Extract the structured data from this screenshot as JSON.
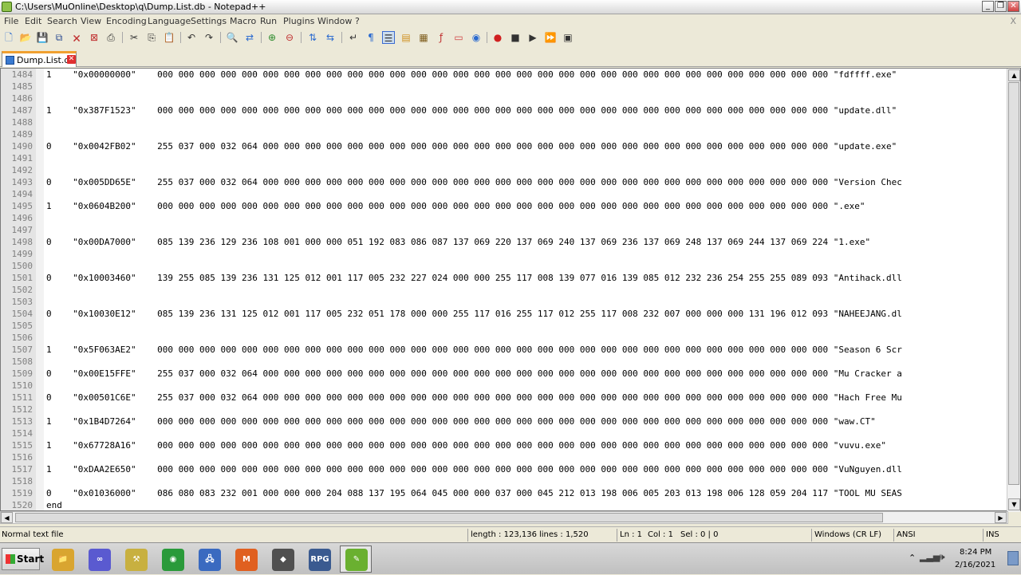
{
  "window": {
    "title": "C:\\Users\\MuOnline\\Desktop\\q\\Dump.List.db - Notepad++",
    "minimize": "_",
    "restore": "❐",
    "close": "✕"
  },
  "menu": [
    "File",
    "Edit",
    "Search",
    "View",
    "Encoding",
    "Language",
    "Settings",
    "Macro",
    "Run",
    "Plugins",
    "Window",
    "?"
  ],
  "menu_close": "X",
  "toolbar": [
    "new-file",
    "open-file",
    "save",
    "save-all",
    "close",
    "close-all",
    "print",
    "cut",
    "copy",
    "paste",
    "undo",
    "redo",
    "find",
    "replace",
    "zoom-in",
    "zoom-out",
    "sync-vertical",
    "sync-horizontal",
    "word-wrap",
    "show-all-chars",
    "indent-guide",
    "language",
    "doc-map",
    "function-list",
    "folder-workspace",
    "monitor",
    "record-macro",
    "stop-record",
    "play-macro",
    "run-macro-multiple",
    "save-macro"
  ],
  "tab": {
    "label": "Dump.List.db",
    "close": "✕"
  },
  "editor": {
    "lines": [
      {
        "n": "1484",
        "t": "1    \"0x00000000\"    000 000 000 000 000 000 000 000 000 000 000 000 000 000 000 000 000 000 000 000 000 000 000 000 000 000 000 000 000 000 000 000 \"fdffff.exe\""
      },
      {
        "n": "1485",
        "t": ""
      },
      {
        "n": "1486",
        "t": ""
      },
      {
        "n": "1487",
        "t": "1    \"0x387F1523\"    000 000 000 000 000 000 000 000 000 000 000 000 000 000 000 000 000 000 000 000 000 000 000 000 000 000 000 000 000 000 000 000 \"update.dll\""
      },
      {
        "n": "1488",
        "t": ""
      },
      {
        "n": "1489",
        "t": ""
      },
      {
        "n": "1490",
        "t": "0    \"0x0042FB02\"    255 037 000 032 064 000 000 000 000 000 000 000 000 000 000 000 000 000 000 000 000 000 000 000 000 000 000 000 000 000 000 000 \"update.exe\""
      },
      {
        "n": "1491",
        "t": ""
      },
      {
        "n": "1492",
        "t": ""
      },
      {
        "n": "1493",
        "t": "0    \"0x005DD65E\"    255 037 000 032 064 000 000 000 000 000 000 000 000 000 000 000 000 000 000 000 000 000 000 000 000 000 000 000 000 000 000 000 \"Version Chec"
      },
      {
        "n": "1494",
        "t": ""
      },
      {
        "n": "1495",
        "t": "1    \"0x0604B200\"    000 000 000 000 000 000 000 000 000 000 000 000 000 000 000 000 000 000 000 000 000 000 000 000 000 000 000 000 000 000 000 000 \".exe\""
      },
      {
        "n": "1496",
        "t": ""
      },
      {
        "n": "1497",
        "t": ""
      },
      {
        "n": "1498",
        "t": "0    \"0x00DA7000\"    085 139 236 129 236 108 001 000 000 051 192 083 086 087 137 069 220 137 069 240 137 069 236 137 069 248 137 069 244 137 069 224 \"1.exe\""
      },
      {
        "n": "1499",
        "t": ""
      },
      {
        "n": "1500",
        "t": ""
      },
      {
        "n": "1501",
        "t": "0    \"0x10003460\"    139 255 085 139 236 131 125 012 001 117 005 232 227 024 000 000 255 117 008 139 077 016 139 085 012 232 236 254 255 255 089 093 \"Antihack.dll"
      },
      {
        "n": "1502",
        "t": ""
      },
      {
        "n": "1503",
        "t": ""
      },
      {
        "n": "1504",
        "t": "0    \"0x10030E12\"    085 139 236 131 125 012 001 117 005 232 051 178 000 000 255 117 016 255 117 012 255 117 008 232 007 000 000 000 131 196 012 093 \"NAHEEJANG.dl"
      },
      {
        "n": "1505",
        "t": ""
      },
      {
        "n": "1506",
        "t": ""
      },
      {
        "n": "1507",
        "t": "1    \"0x5F063AE2\"    000 000 000 000 000 000 000 000 000 000 000 000 000 000 000 000 000 000 000 000 000 000 000 000 000 000 000 000 000 000 000 000 \"Season 6 Scr"
      },
      {
        "n": "1508",
        "t": ""
      },
      {
        "n": "1509",
        "t": "0    \"0x00E15FFE\"    255 037 000 032 064 000 000 000 000 000 000 000 000 000 000 000 000 000 000 000 000 000 000 000 000 000 000 000 000 000 000 000 \"Mu Cracker a"
      },
      {
        "n": "1510",
        "t": ""
      },
      {
        "n": "1511",
        "t": "0    \"0x00501C6E\"    255 037 000 032 064 000 000 000 000 000 000 000 000 000 000 000 000 000 000 000 000 000 000 000 000 000 000 000 000 000 000 000 \"Hach Free Mu"
      },
      {
        "n": "1512",
        "t": ""
      },
      {
        "n": "1513",
        "t": "1    \"0x1B4D7264\"    000 000 000 000 000 000 000 000 000 000 000 000 000 000 000 000 000 000 000 000 000 000 000 000 000 000 000 000 000 000 000 000 \"waw.CT\""
      },
      {
        "n": "1514",
        "t": ""
      },
      {
        "n": "1515",
        "t": "1    \"0x67728A16\"    000 000 000 000 000 000 000 000 000 000 000 000 000 000 000 000 000 000 000 000 000 000 000 000 000 000 000 000 000 000 000 000 \"vuvu.exe\""
      },
      {
        "n": "1516",
        "t": ""
      },
      {
        "n": "1517",
        "t": "1    \"0xDAA2E650\"    000 000 000 000 000 000 000 000 000 000 000 000 000 000 000 000 000 000 000 000 000 000 000 000 000 000 000 000 000 000 000 000 \"VuNguyen.dll"
      },
      {
        "n": "1518",
        "t": ""
      },
      {
        "n": "1519",
        "t": "0    \"0x01036000\"    086 080 083 232 001 000 000 000 204 088 137 195 064 045 000 000 037 000 045 212 013 198 006 005 203 013 198 006 128 059 204 117 \"TOOL MU SEAS"
      },
      {
        "n": "1520",
        "t": "end"
      }
    ]
  },
  "status": {
    "file_type": "Normal text file",
    "length": "length : 123,136",
    "lines": "lines : 1,520",
    "ln": "Ln : 1",
    "col": "Col : 1",
    "sel": "Sel : 0 | 0",
    "eol": "Windows (CR LF)",
    "encoding": "ANSI",
    "mode": "INS"
  },
  "taskbar": {
    "start": "Start",
    "apps": [
      {
        "name": "explorer",
        "color": "#d9a530",
        "glyph": "📁"
      },
      {
        "name": "link",
        "color": "#5a5ad0",
        "glyph": "∞"
      },
      {
        "name": "tools",
        "color": "#c8b040",
        "glyph": "⚒"
      },
      {
        "name": "chrome",
        "color": "#2a9a3a",
        "glyph": "◉"
      },
      {
        "name": "network",
        "color": "#3a6ac0",
        "glyph": "🖧"
      },
      {
        "name": "mu-client",
        "color": "#e06020",
        "glyph": "M"
      },
      {
        "name": "cube",
        "color": "#505050",
        "glyph": "◆"
      },
      {
        "name": "rpg",
        "color": "#3a5a90",
        "glyph": "RPG"
      },
      {
        "name": "notepad-pp",
        "color": "#6ab030",
        "glyph": "✎"
      }
    ],
    "clock_time": "8:24 PM",
    "clock_date": "2/16/2021"
  }
}
